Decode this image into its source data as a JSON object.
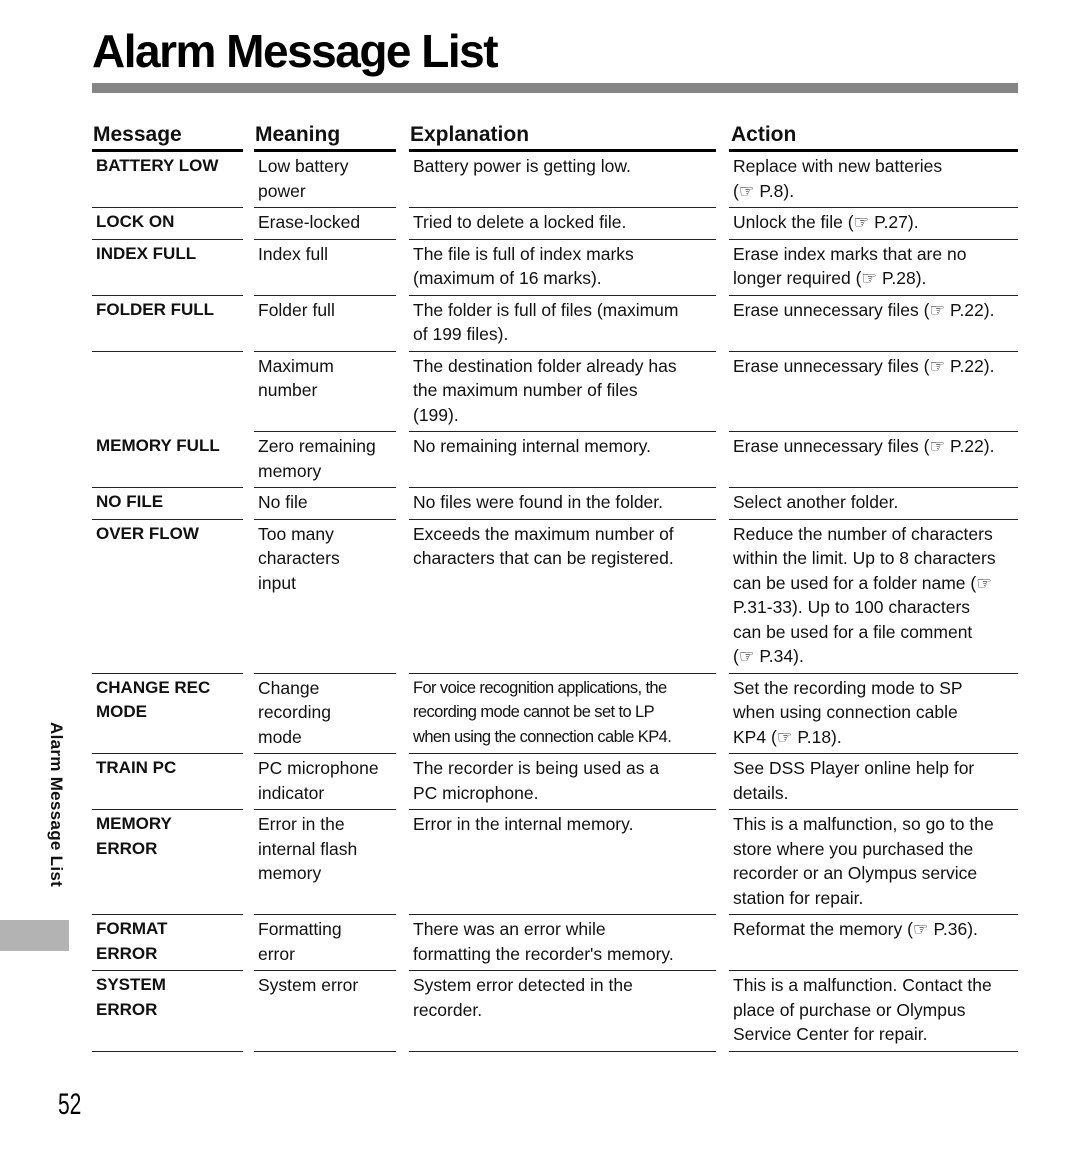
{
  "page": {
    "title": "Alarm Message List",
    "side_label": "Alarm Message List",
    "page_number": "52",
    "colors": {
      "title_bar": "#858585",
      "side_tab": "#b3b3b3",
      "rule": "#222222"
    }
  },
  "table": {
    "headers": [
      "Message",
      "Meaning",
      "Explanation",
      "Action"
    ],
    "ref_icon": "☞",
    "rows": [
      {
        "message": [
          "BATTERY LOW"
        ],
        "meaning": [
          "Low battery",
          "power"
        ],
        "explanation": [
          "Battery power is getting low."
        ],
        "action": [
          "Replace with new batteries",
          "(☞ P.8)."
        ]
      },
      {
        "message": [
          "LOCK ON"
        ],
        "meaning": [
          "Erase-locked"
        ],
        "explanation": [
          "Tried to delete a locked file."
        ],
        "action": [
          "Unlock the file (☞ P.27)."
        ]
      },
      {
        "message": [
          "INDEX FULL"
        ],
        "meaning": [
          "Index full"
        ],
        "explanation": [
          "The file is full of index marks",
          "(maximum of 16 marks)."
        ],
        "action": [
          "Erase index marks that are no",
          "longer required (☞ P.28)."
        ]
      },
      {
        "message": [
          "FOLDER FULL"
        ],
        "meaning": [
          "Folder full"
        ],
        "explanation": [
          "The folder is full of files (maximum",
          "of 199 files)."
        ],
        "action": [
          "Erase unnecessary files (☞ P.22)."
        ]
      },
      {
        "message": [],
        "meaning": [
          "Maximum",
          "number"
        ],
        "explanation": [
          "The destination folder already has",
          "the maximum number of files",
          "(199)."
        ],
        "action": [
          "Erase unnecessary files (☞ P.22)."
        ]
      },
      {
        "message": [
          "MEMORY FULL"
        ],
        "meaning": [
          "Zero remaining",
          "memory"
        ],
        "explanation": [
          "No remaining internal memory."
        ],
        "action": [
          "Erase unnecessary files (☞ P.22)."
        ]
      },
      {
        "message": [
          "NO FILE"
        ],
        "meaning": [
          "No file"
        ],
        "explanation": [
          "No files were found in the folder."
        ],
        "action": [
          "Select another folder."
        ]
      },
      {
        "message": [
          "OVER FLOW"
        ],
        "meaning": [
          "Too many",
          "characters",
          "input"
        ],
        "explanation": [
          "Exceeds the maximum number of",
          "characters that can be registered."
        ],
        "action": [
          "Reduce the number of characters",
          "within the limit. Up to 8 characters",
          "can be used for a folder name (☞",
          "P.31-33). Up to 100 characters",
          "can be used for a file comment",
          "(☞ P.34)."
        ]
      },
      {
        "message": [
          "CHANGE REC",
          "MODE"
        ],
        "meaning": [
          "Change",
          "recording",
          "mode"
        ],
        "explanation": [
          "For voice recognition applications, the",
          "recording mode cannot be set to LP",
          "when using the connection cable KP4."
        ],
        "explanation_condensed": true,
        "action": [
          "Set the recording mode to SP",
          "when using connection cable",
          "KP4 (☞ P.18)."
        ]
      },
      {
        "message": [
          "TRAIN PC"
        ],
        "meaning": [
          "PC microphone",
          "indicator"
        ],
        "explanation": [
          "The recorder is being used as a",
          "PC microphone."
        ],
        "action": [
          "See DSS Player online help for",
          "details."
        ]
      },
      {
        "message": [
          "MEMORY",
          "ERROR"
        ],
        "meaning": [
          "Error in the",
          "internal flash",
          "memory"
        ],
        "explanation": [
          "Error in the internal memory."
        ],
        "action": [
          "This is a malfunction, so go to the",
          "store where you purchased the",
          "recorder or an Olympus service",
          "station for repair."
        ]
      },
      {
        "message": [
          "FORMAT",
          "ERROR"
        ],
        "meaning": [
          "Formatting",
          "error"
        ],
        "explanation": [
          "There was an error while",
          "formatting the recorder's memory."
        ],
        "action": [
          "Reformat the memory (☞ P.36)."
        ]
      },
      {
        "message": [
          "SYSTEM",
          "ERROR"
        ],
        "meaning": [
          "System error"
        ],
        "explanation": [
          "System error detected in the",
          "recorder."
        ],
        "action": [
          "This is a malfunction. Contact the",
          "place of purchase or Olympus",
          "Service Center for repair."
        ]
      }
    ]
  }
}
